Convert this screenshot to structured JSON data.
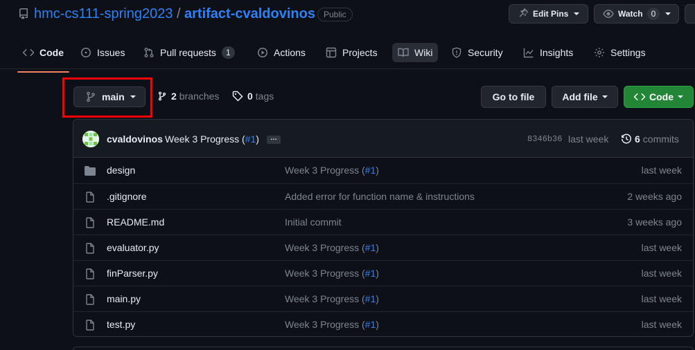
{
  "header": {
    "owner": "hmc-cs111-spring2023",
    "slash": "/",
    "repo": "artifact-cvaldovinos",
    "visibility": "Public",
    "edit_pins": "Edit Pins",
    "watch_label": "Watch",
    "watch_count": "0"
  },
  "nav": {
    "tabs": [
      {
        "label": "Code",
        "icon": "code-icon"
      },
      {
        "label": "Issues",
        "icon": "issue-icon"
      },
      {
        "label": "Pull requests",
        "icon": "pull-request-icon",
        "count": "1"
      },
      {
        "label": "Actions",
        "icon": "play-icon"
      },
      {
        "label": "Projects",
        "icon": "table-icon"
      },
      {
        "label": "Wiki",
        "icon": "book-icon"
      },
      {
        "label": "Security",
        "icon": "shield-icon"
      },
      {
        "label": "Insights",
        "icon": "graph-icon"
      },
      {
        "label": "Settings",
        "icon": "gear-icon"
      }
    ]
  },
  "toolbar": {
    "branch": "main",
    "branches_count": "2",
    "branches_label": "branches",
    "tags_count": "0",
    "tags_label": "tags",
    "go_to_file": "Go to file",
    "add_file": "Add file",
    "code": "Code"
  },
  "commit": {
    "author": "cvaldovinos",
    "message_prefix": "Week 3 Progress (",
    "message_link": "#1",
    "message_suffix": ")",
    "ellipsis": "…",
    "sha": "8346b36",
    "time": "last week",
    "commits_count": "6",
    "commits_label": "commits"
  },
  "files": [
    {
      "name": "design",
      "type": "folder",
      "msg_prefix": "Week 3 Progress (",
      "msg_link": "#1",
      "msg_suffix": ")",
      "age": "last week"
    },
    {
      "name": ".gitignore",
      "type": "file",
      "msg_prefix": "Added error for function name & instructions",
      "msg_link": "",
      "msg_suffix": "",
      "age": "2 weeks ago"
    },
    {
      "name": "README.md",
      "type": "file",
      "msg_prefix": "Initial commit",
      "msg_link": "",
      "msg_suffix": "",
      "age": "3 weeks ago"
    },
    {
      "name": "evaluator.py",
      "type": "file",
      "msg_prefix": "Week 3 Progress (",
      "msg_link": "#1",
      "msg_suffix": ")",
      "age": "last week"
    },
    {
      "name": "finParser.py",
      "type": "file",
      "msg_prefix": "Week 3 Progress (",
      "msg_link": "#1",
      "msg_suffix": ")",
      "age": "last week"
    },
    {
      "name": "main.py",
      "type": "file",
      "msg_prefix": "Week 3 Progress (",
      "msg_link": "#1",
      "msg_suffix": ")",
      "age": "last week"
    },
    {
      "name": "test.py",
      "type": "file",
      "msg_prefix": "Week 3 Progress (",
      "msg_link": "#1",
      "msg_suffix": ")",
      "age": "last week"
    }
  ],
  "colors": {
    "background": "#0d1117",
    "link": "#2f81f7",
    "muted": "#7d8590",
    "primary_button": "#238636",
    "active_tab_underline": "#f78166",
    "highlight_box": "#ff0000"
  }
}
